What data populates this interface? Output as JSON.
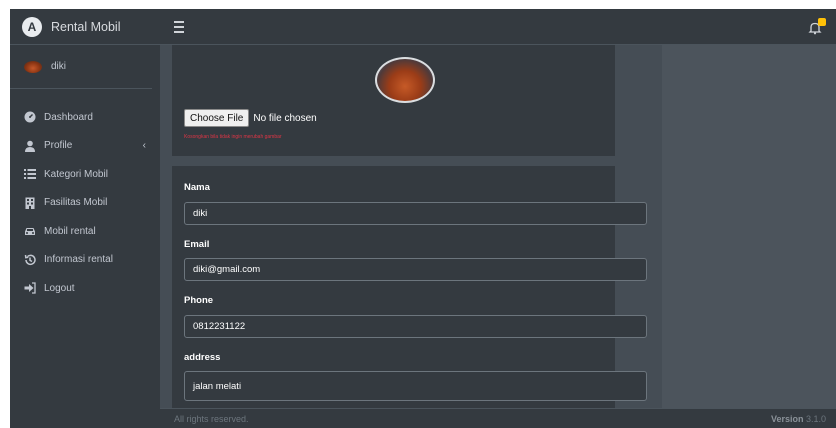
{
  "brand": {
    "title": "Rental Mobil"
  },
  "user": {
    "name": "diki"
  },
  "sidebar": {
    "items": [
      {
        "label": "Dashboard",
        "icon": "dashboard-icon"
      },
      {
        "label": "Profile",
        "icon": "user-icon",
        "has_arrow": true
      },
      {
        "label": "Kategori Mobil",
        "icon": "list-icon"
      },
      {
        "label": "Fasilitas Mobil",
        "icon": "building-icon"
      },
      {
        "label": "Mobil rental",
        "icon": "car-icon"
      },
      {
        "label": "Informasi rental",
        "icon": "history-icon"
      },
      {
        "label": "Logout",
        "icon": "logout-icon"
      }
    ]
  },
  "photo": {
    "choose_label": "Choose File",
    "status": "No file chosen",
    "hint": "Kosongkan bila tidak ingin merubah gambar"
  },
  "form": {
    "fields": [
      {
        "label": "Nama",
        "value": "diki"
      },
      {
        "label": "Email",
        "value": "diki@gmail.com"
      },
      {
        "label": "Phone",
        "value": "0812231122"
      },
      {
        "label": "address",
        "value": "jalan melati"
      }
    ]
  },
  "footer": {
    "left": "All rights reserved.",
    "version_label": "Version",
    "version_number": "3.1.0"
  },
  "colors": {
    "sidebar_bg": "#343a40",
    "content_bg": "#454d55",
    "badge": "#ffc107",
    "hint": "#dc3545"
  }
}
